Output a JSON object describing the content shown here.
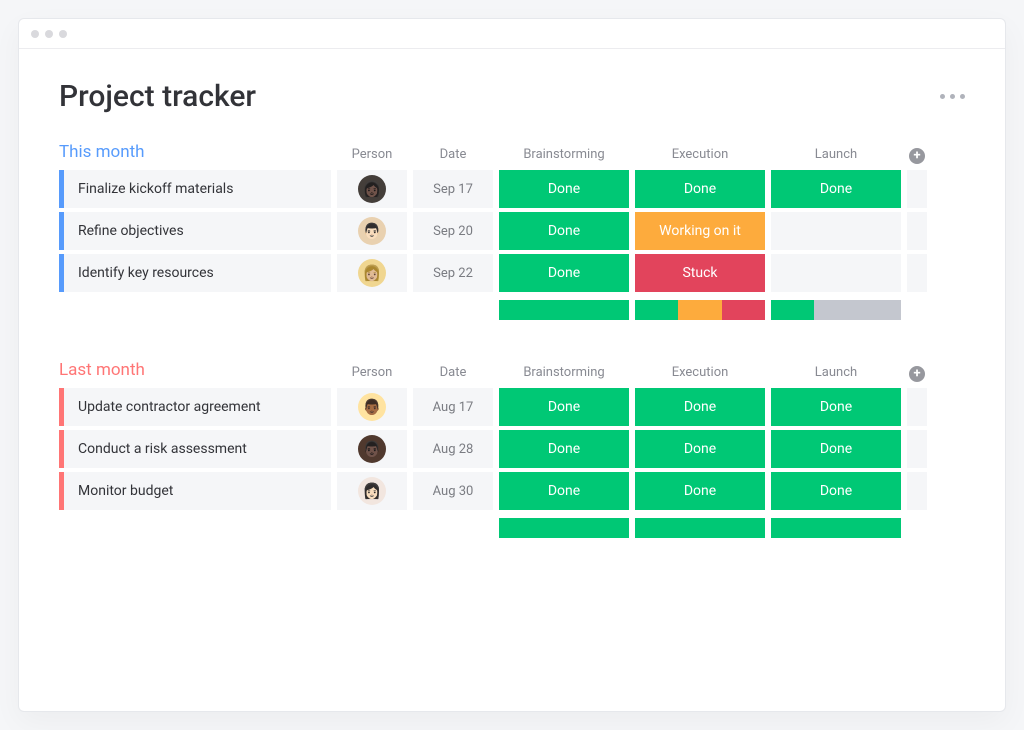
{
  "colors": {
    "done": "#00C875",
    "working": "#FDAB3D",
    "stuck": "#E2445C",
    "empty": "#C4C7CF",
    "group1": "#579BFC",
    "group2": "#FF7575"
  },
  "page_title": "Project tracker",
  "columns": [
    "Person",
    "Date",
    "Brainstorming",
    "Execution",
    "Launch"
  ],
  "groups": [
    {
      "title": "This month",
      "color_key": "group1",
      "rows": [
        {
          "task": "Finalize kickoff materials",
          "avatar_bg": "#443e3a",
          "avatar_emoji": "👩🏿",
          "date": "Sep 17",
          "statuses": [
            {
              "label": "Done",
              "key": "done"
            },
            {
              "label": "Done",
              "key": "done"
            },
            {
              "label": "Done",
              "key": "done"
            }
          ]
        },
        {
          "task": "Refine objectives",
          "avatar_bg": "#e9d1b0",
          "avatar_emoji": "👨🏻",
          "date": "Sep 20",
          "statuses": [
            {
              "label": "Done",
              "key": "done"
            },
            {
              "label": "Working on it",
              "key": "working"
            },
            {
              "label": "",
              "key": "empty"
            }
          ]
        },
        {
          "task": "Identify key resources",
          "avatar_bg": "#f0d690",
          "avatar_emoji": "👩🏼",
          "date": "Sep 22",
          "statuses": [
            {
              "label": "Done",
              "key": "done"
            },
            {
              "label": "Stuck",
              "key": "stuck"
            },
            {
              "label": "",
              "key": "empty"
            }
          ]
        }
      ],
      "summary": [
        [
          {
            "key": "done",
            "pct": 100
          }
        ],
        [
          {
            "key": "done",
            "pct": 33.3
          },
          {
            "key": "working",
            "pct": 33.3
          },
          {
            "key": "stuck",
            "pct": 33.4
          }
        ],
        [
          {
            "key": "done",
            "pct": 33.3
          },
          {
            "key": "empty",
            "pct": 66.7
          }
        ]
      ]
    },
    {
      "title": "Last month",
      "color_key": "group2",
      "rows": [
        {
          "task": "Update contractor agreement",
          "avatar_bg": "#ffe3a0",
          "avatar_emoji": "👨🏾",
          "date": "Aug 17",
          "statuses": [
            {
              "label": "Done",
              "key": "done"
            },
            {
              "label": "Done",
              "key": "done"
            },
            {
              "label": "Done",
              "key": "done"
            }
          ]
        },
        {
          "task": "Conduct a risk assessment",
          "avatar_bg": "#50392e",
          "avatar_emoji": "👨🏿",
          "date": "Aug 28",
          "statuses": [
            {
              "label": "Done",
              "key": "done"
            },
            {
              "label": "Done",
              "key": "done"
            },
            {
              "label": "Done",
              "key": "done"
            }
          ]
        },
        {
          "task": "Monitor budget",
          "avatar_bg": "#f2e6df",
          "avatar_emoji": "👩🏻",
          "date": "Aug 30",
          "statuses": [
            {
              "label": "Done",
              "key": "done"
            },
            {
              "label": "Done",
              "key": "done"
            },
            {
              "label": "Done",
              "key": "done"
            }
          ]
        }
      ],
      "summary": [
        [
          {
            "key": "done",
            "pct": 100
          }
        ],
        [
          {
            "key": "done",
            "pct": 100
          }
        ],
        [
          {
            "key": "done",
            "pct": 100
          }
        ]
      ]
    }
  ]
}
